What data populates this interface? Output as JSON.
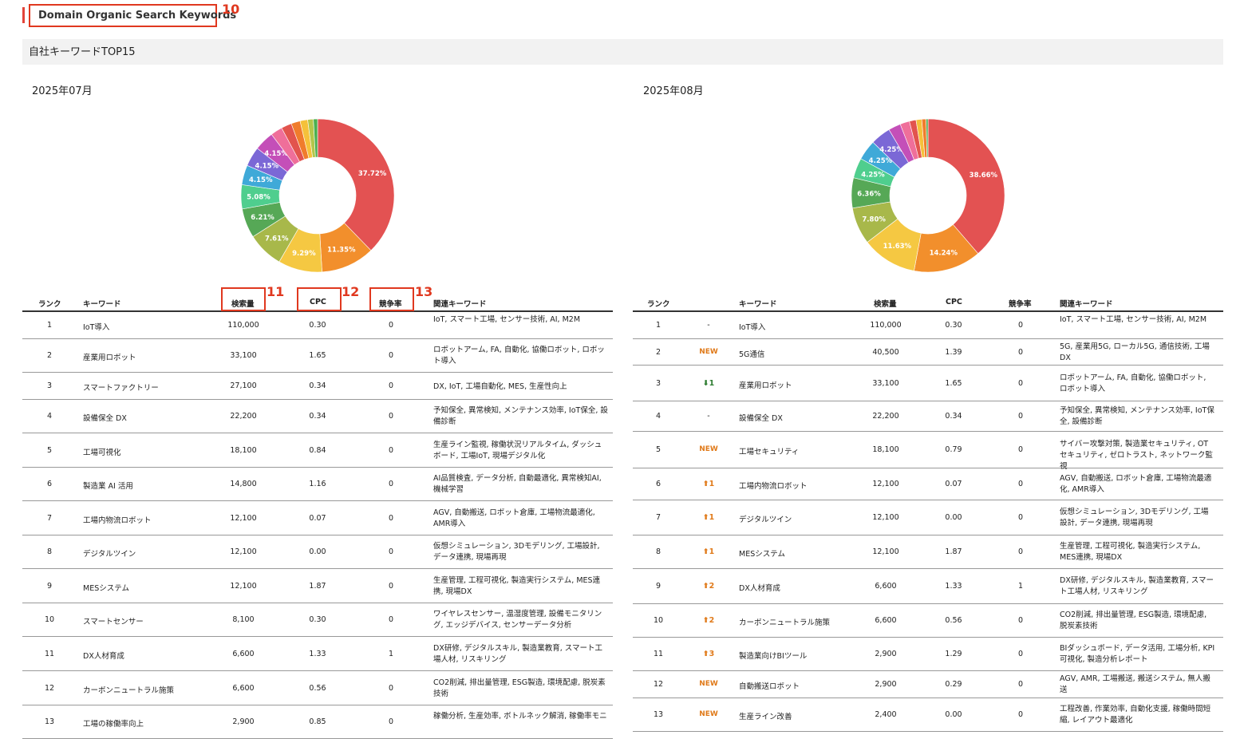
{
  "header": {
    "title": "Domain Organic Search Keywords",
    "callout_title": "10"
  },
  "section": {
    "title": "自社キーワードTOP15"
  },
  "left": {
    "month": "2025年07月",
    "callouts": {
      "volume": "11",
      "cpc": "12",
      "competition": "13"
    },
    "columns": {
      "rank": "ランク",
      "keyword": "キーワード",
      "volume": "検索量",
      "cpc": "CPC",
      "competition": "競争率",
      "related": "関連キーワード"
    },
    "rows": [
      {
        "rank": "1",
        "keyword": "IoT導入",
        "volume": "110,000",
        "cpc": "0.30",
        "competition": "0",
        "related": "IoT, スマート工場, センサー技術, AI, M2M"
      },
      {
        "rank": "2",
        "keyword": "産業用ロボット",
        "volume": "33,100",
        "cpc": "1.65",
        "competition": "0",
        "related": "ロボットアーム, FA, 自動化, 協働ロボット, ロボット導入"
      },
      {
        "rank": "3",
        "keyword": "スマートファクトリー",
        "volume": "27,100",
        "cpc": "0.34",
        "competition": "0",
        "related": "DX, IoT, 工場自動化, MES, 生産性向上"
      },
      {
        "rank": "4",
        "keyword": "設備保全 DX",
        "volume": "22,200",
        "cpc": "0.34",
        "competition": "0",
        "related": "予知保全, 異常検知, メンテナンス効率, IoT保全, 設備診断"
      },
      {
        "rank": "5",
        "keyword": "工場可視化",
        "volume": "18,100",
        "cpc": "0.84",
        "competition": "0",
        "related": "生産ライン監視, 稼働状況リアルタイム, ダッシュボード, 工場IoT, 現場デジタル化"
      },
      {
        "rank": "6",
        "keyword": "製造業 AI 活用",
        "volume": "14,800",
        "cpc": "1.16",
        "competition": "0",
        "related": "AI品質検査, データ分析, 自動最適化, 異常検知AI, 機械学習"
      },
      {
        "rank": "7",
        "keyword": "工場内物流ロボット",
        "volume": "12,100",
        "cpc": "0.07",
        "competition": "0",
        "related": "AGV, 自動搬送, ロボット倉庫, 工場物流最適化, AMR導入"
      },
      {
        "rank": "8",
        "keyword": "デジタルツイン",
        "volume": "12,100",
        "cpc": "0.00",
        "competition": "0",
        "related": "仮想シミュレーション, 3Dモデリング, 工場設計, データ連携, 現場再現"
      },
      {
        "rank": "9",
        "keyword": "MESシステム",
        "volume": "12,100",
        "cpc": "1.87",
        "competition": "0",
        "related": "生産管理, 工程可視化, 製造実行システム, MES連携, 現場DX"
      },
      {
        "rank": "10",
        "keyword": "スマートセンサー",
        "volume": "8,100",
        "cpc": "0.30",
        "competition": "0",
        "related": "ワイヤレスセンサー, 温湿度管理, 設備モニタリング, エッジデバイス, センサーデータ分析"
      },
      {
        "rank": "11",
        "keyword": "DX人材育成",
        "volume": "6,600",
        "cpc": "1.33",
        "competition": "1",
        "related": "DX研修, デジタルスキル, 製造業教育, スマート工場人材, リスキリング"
      },
      {
        "rank": "12",
        "keyword": "カーボンニュートラル施策",
        "volume": "6,600",
        "cpc": "0.56",
        "competition": "0",
        "related": "CO2削減, 排出量管理, ESG製造, 環境配慮, 脱炭素技術"
      },
      {
        "rank": "13",
        "keyword": "工場の稼働率向上",
        "volume": "2,900",
        "cpc": "0.85",
        "competition": "0",
        "related": "稼働分析, 生産効率, ボトルネック解消, 稼働率モニ"
      }
    ]
  },
  "right": {
    "month": "2025年08月",
    "columns": {
      "rank": "ランク",
      "keyword": "キーワード",
      "volume": "検索量",
      "cpc": "CPC",
      "competition": "競争率",
      "related": "関連キーワード"
    },
    "rows": [
      {
        "rank": "1",
        "change": "-",
        "keyword": "IoT導入",
        "volume": "110,000",
        "cpc": "0.30",
        "competition": "0",
        "related": "IoT, スマート工場, センサー技術, AI, M2M"
      },
      {
        "rank": "2",
        "change": "NEW",
        "keyword": "5G通信",
        "volume": "40,500",
        "cpc": "1.39",
        "competition": "0",
        "related": "5G, 産業用5G, ローカル5G, 通信技術, 工場DX"
      },
      {
        "rank": "3",
        "change": "⬇1",
        "keyword": "産業用ロボット",
        "volume": "33,100",
        "cpc": "1.65",
        "competition": "0",
        "related": "ロボットアーム, FA, 自動化, 協働ロボット, ロボット導入"
      },
      {
        "rank": "4",
        "change": "-",
        "keyword": "設備保全 DX",
        "volume": "22,200",
        "cpc": "0.34",
        "competition": "0",
        "related": "予知保全, 異常検知, メンテナンス効率, IoT保全, 設備診断"
      },
      {
        "rank": "5",
        "change": "NEW",
        "keyword": "工場セキュリティ",
        "volume": "18,100",
        "cpc": "0.79",
        "competition": "0",
        "related": "サイバー攻撃対策, 製造業セキュリティ, OTセキュリティ, ゼロトラスト, ネットワーク監視"
      },
      {
        "rank": "6",
        "change": "⬆1",
        "keyword": "工場内物流ロボット",
        "volume": "12,100",
        "cpc": "0.07",
        "competition": "0",
        "related": "AGV, 自動搬送, ロボット倉庫, 工場物流最適化, AMR導入"
      },
      {
        "rank": "7",
        "change": "⬆1",
        "keyword": "デジタルツイン",
        "volume": "12,100",
        "cpc": "0.00",
        "competition": "0",
        "related": "仮想シミュレーション, 3Dモデリング, 工場設計, データ連携, 現場再現"
      },
      {
        "rank": "8",
        "change": "⬆1",
        "keyword": "MESシステム",
        "volume": "12,100",
        "cpc": "1.87",
        "competition": "0",
        "related": "生産管理, 工程可視化, 製造実行システム, MES連携, 現場DX"
      },
      {
        "rank": "9",
        "change": "⬆2",
        "keyword": "DX人材育成",
        "volume": "6,600",
        "cpc": "1.33",
        "competition": "1",
        "related": "DX研修, デジタルスキル, 製造業教育, スマート工場人材, リスキリング"
      },
      {
        "rank": "10",
        "change": "⬆2",
        "keyword": "カーボンニュートラル施策",
        "volume": "6,600",
        "cpc": "0.56",
        "competition": "0",
        "related": "CO2削減, 排出量管理, ESG製造, 環境配慮, 脱炭素技術"
      },
      {
        "rank": "11",
        "change": "⬆3",
        "keyword": "製造業向けBIツール",
        "volume": "2,900",
        "cpc": "1.29",
        "competition": "0",
        "related": "BIダッシュボード, データ活用, 工場分析, KPI可視化, 製造分析レポート"
      },
      {
        "rank": "12",
        "change": "NEW",
        "keyword": "自動搬送ロボット",
        "volume": "2,900",
        "cpc": "0.29",
        "competition": "0",
        "related": "AGV, AMR, 工場搬送, 搬送システム, 無人搬送"
      },
      {
        "rank": "13",
        "change": "NEW",
        "keyword": "生産ライン改善",
        "volume": "2,400",
        "cpc": "0.00",
        "competition": "0",
        "related": "工程改善, 作業効率, 自動化支援, 稼働時間短縮, レイアウト最適化"
      }
    ]
  },
  "chart_data": [
    {
      "type": "pie",
      "title": "2025年07月",
      "donut": true,
      "values": [
        37.72,
        11.35,
        9.29,
        7.61,
        6.21,
        5.08,
        4.15,
        4.15,
        4.15,
        2.5,
        2.2,
        1.9,
        1.6,
        1.2,
        0.88
      ],
      "labels": [
        "37.72%",
        "11.35%",
        "9.29%",
        "7.61%",
        "6.21%",
        "5.08%",
        "4.15%",
        "4.15%",
        "4.15%",
        "",
        "",
        "",
        "",
        "",
        ""
      ],
      "colors": [
        "#e35252",
        "#f28f2c",
        "#f5c842",
        "#a8b84a",
        "#56a856",
        "#4fce8e",
        "#3fa9d8",
        "#7b68d6",
        "#c44fb8",
        "#ef6f9a",
        "#e2544e",
        "#f07c2c",
        "#f5c13a",
        "#b4c64a",
        "#4caf50"
      ]
    },
    {
      "type": "pie",
      "title": "2025年08月",
      "donut": true,
      "values": [
        38.66,
        14.24,
        11.63,
        7.8,
        6.36,
        4.25,
        4.25,
        4.25,
        2.6,
        2.0,
        1.4,
        1.2,
        0.9,
        0.41
      ],
      "labels": [
        "38.66%",
        "14.24%",
        "11.63%",
        "7.80%",
        "6.36%",
        "4.25%",
        "4.25%",
        "4.25%",
        "",
        "",
        "",
        "",
        "",
        ""
      ],
      "colors": [
        "#e35252",
        "#f28f2c",
        "#f5c842",
        "#a8b84a",
        "#56a856",
        "#4fce8e",
        "#3fa9d8",
        "#7b68d6",
        "#c44fb8",
        "#ef6f9a",
        "#e2544e",
        "#f5c13a",
        "#f07c2c",
        "#4caf50"
      ]
    }
  ]
}
